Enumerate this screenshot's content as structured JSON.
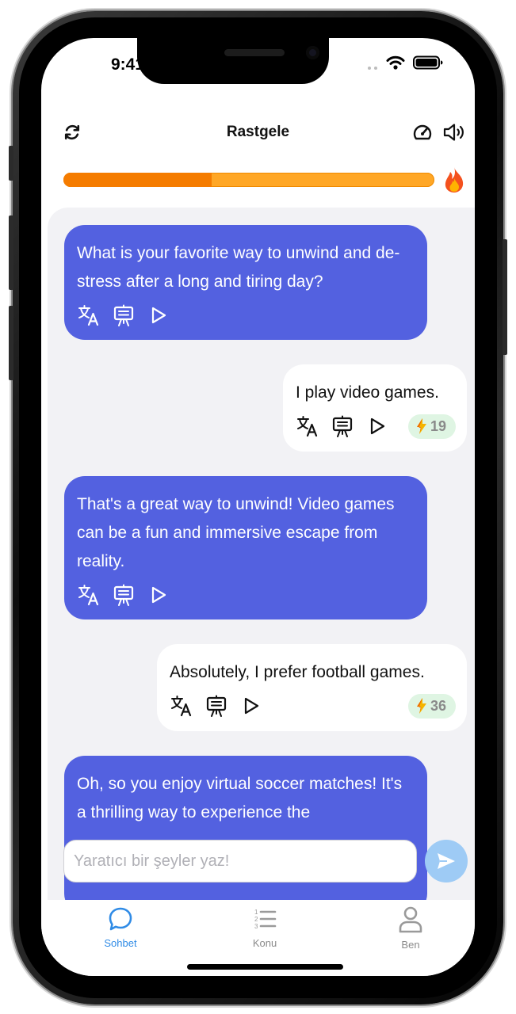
{
  "status_bar": {
    "time": "9:41"
  },
  "header": {
    "title": "Rastgele"
  },
  "progress": {
    "value_percent": 40
  },
  "colors": {
    "bot_bubble": "#5361e0",
    "user_bubble": "#ffffff",
    "progress_fill": "#f57c00",
    "progress_track": "#ffa726",
    "active_tab": "#2f8be6",
    "send_button": "#9ecbf5",
    "score_badge": "#dff5e3"
  },
  "messages": [
    {
      "role": "bot",
      "text": "What is your favorite way to unwind and de-stress after a long and tiring day?"
    },
    {
      "role": "user",
      "text": "I play video games.",
      "score": "19"
    },
    {
      "role": "bot",
      "text": "That's a great way to unwind! Video games can be a fun and immersive escape from reality."
    },
    {
      "role": "user",
      "text": "Absolutely, I prefer football games.",
      "score": "36"
    },
    {
      "role": "bot",
      "text": "Oh, so you enjoy virtual soccer matches! It's a thrilling way to experience the"
    }
  ],
  "input": {
    "placeholder": "Yaratıcı bir şeyler yaz!",
    "value": ""
  },
  "tabs": [
    {
      "label": "Sohbet",
      "icon": "chat-bubble-icon",
      "active": true
    },
    {
      "label": "Konu",
      "icon": "numbered-list-icon",
      "active": false
    },
    {
      "label": "Ben",
      "icon": "person-icon",
      "active": false
    }
  ],
  "icons": {
    "refresh": "refresh-icon",
    "speedometer": "speedometer-icon",
    "speaker": "speaker-icon",
    "fire": "fire-icon",
    "translate": "translate-icon",
    "teacher": "teacher-board-icon",
    "play": "play-icon",
    "bolt": "lightning-bolt-icon",
    "send": "send-icon"
  }
}
